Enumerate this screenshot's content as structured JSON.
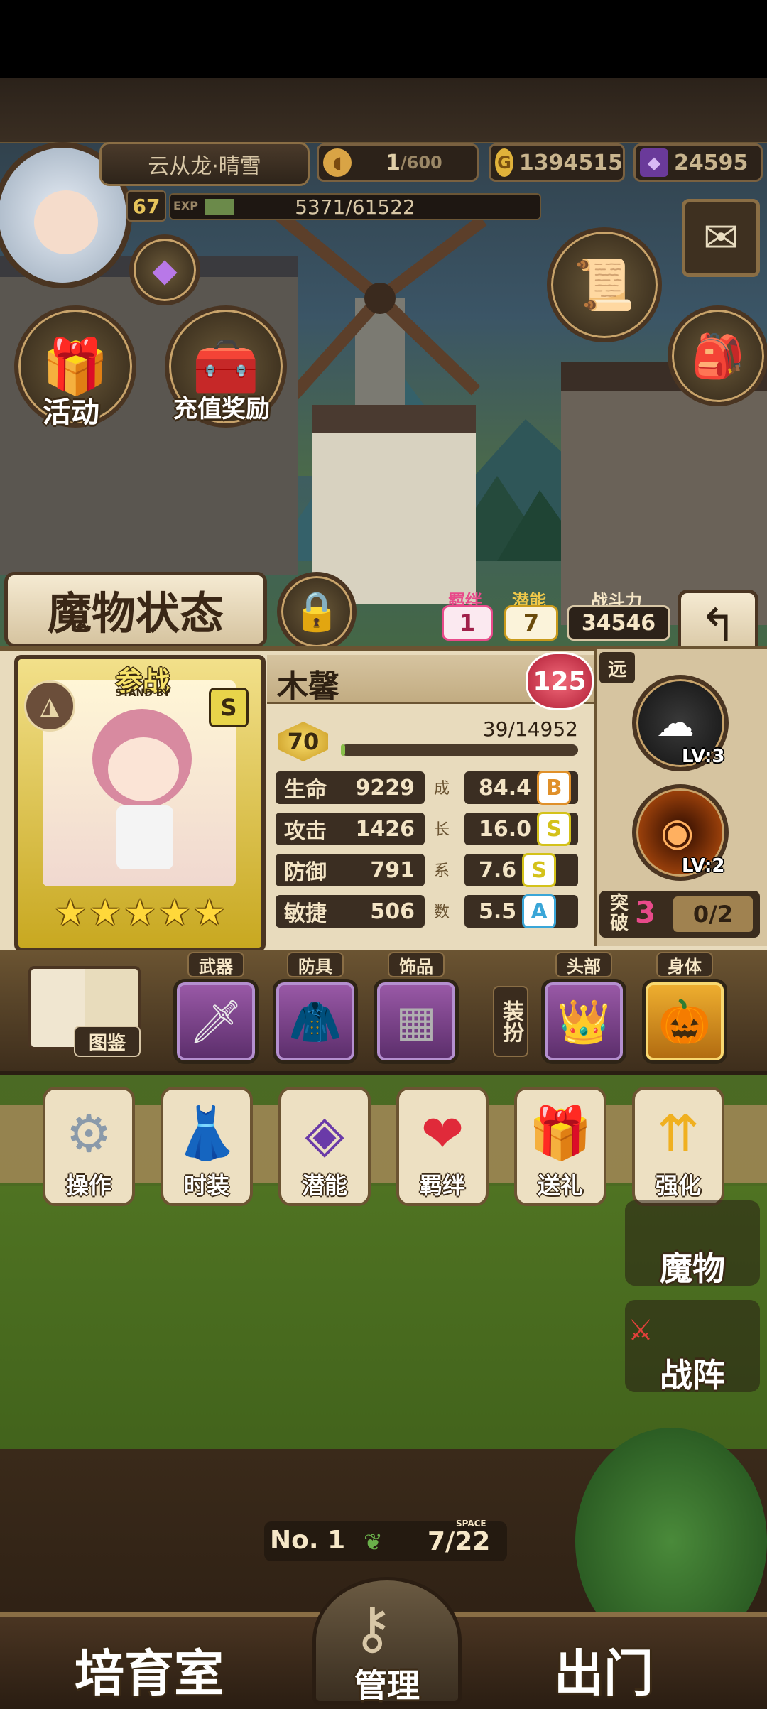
{
  "player": {
    "name": "云从龙·晴雪",
    "level": "67",
    "exp_label": "EXP",
    "exp": "5371/61522",
    "exp_fraction": 0.087
  },
  "resources": {
    "stamina": "1",
    "stamina_max": "/600",
    "gold": "1394515",
    "gems": "24595"
  },
  "top_buttons": {
    "activity": "活动",
    "recharge_reward": "充值奖励"
  },
  "monster_status": {
    "title": "魔物状态",
    "bond_label": "羁绊",
    "bond_value": "1",
    "potential_label": "潜能",
    "potential_value": "7",
    "power_label": "战斗力",
    "power_value": "34546"
  },
  "monster": {
    "name": "木馨",
    "badge": "125",
    "stand_by": "参战",
    "stand_by_en": "STAND BY",
    "rank_letter": "S",
    "stars": 5,
    "level": "70",
    "exp": "39/14952",
    "exp_fraction": 0.003,
    "range_label": "远",
    "growth_label": [
      "成",
      "长",
      "系",
      "数"
    ],
    "stats": [
      {
        "label": "生命",
        "value": "9229",
        "growth": "84.4",
        "grade": "B"
      },
      {
        "label": "攻击",
        "value": "1426",
        "growth": "16.0",
        "grade": "S"
      },
      {
        "label": "防御",
        "value": "791",
        "growth": "7.6",
        "grade": "S"
      },
      {
        "label": "敏捷",
        "value": "506",
        "growth": "5.5",
        "grade": "A"
      }
    ],
    "skills": [
      {
        "level": "LV:3"
      },
      {
        "level": "LV:2"
      }
    ],
    "breakthrough_label": "突破",
    "breakthrough_value": "3",
    "breakthrough_progress": "0/2"
  },
  "equipment": {
    "codex": "图鉴",
    "weapon": "武器",
    "armor": "防具",
    "accessory": "饰品",
    "dressup": "装扮",
    "head": "头部",
    "body": "身体"
  },
  "menu": [
    "操作",
    "时装",
    "潜能",
    "羁绊",
    "送礼",
    "强化"
  ],
  "side_buttons": {
    "monster": "魔物",
    "formation": "战阵"
  },
  "room": {
    "number": "No. 1",
    "space_label": "SPACE",
    "space": "7/22"
  },
  "bottom_nav": {
    "nursery": "培育室",
    "manage": "管理",
    "exit": "出门"
  },
  "colors": {
    "grade_B": "#e0902a",
    "grade_S": "#d4c21a",
    "grade_A": "#3aa6d8",
    "bond": "#e84a8a",
    "potential": "#c99a1a"
  }
}
